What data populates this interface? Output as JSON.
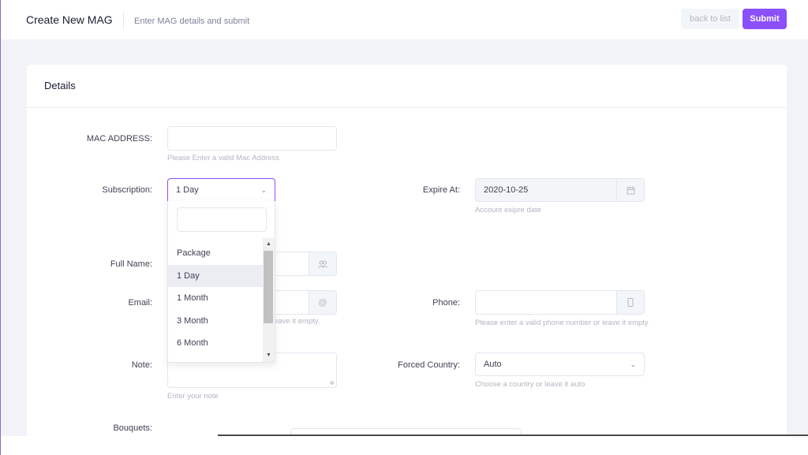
{
  "header": {
    "title": "Create New MAG",
    "subtitle": "Enter MAG details and submit",
    "back_label": "back to list",
    "submit_label": "Submit"
  },
  "card": {
    "title": "Details"
  },
  "form": {
    "mac": {
      "label": "MAC ADDRESS:",
      "value": "",
      "hint": "Please Enter a valid Mac Address"
    },
    "subscription": {
      "label": "Subscription:",
      "selected": "1 Day",
      "options": [
        "Package",
        "1 Day",
        "1 Month",
        "3 Month",
        "6 Month"
      ],
      "active_index": 1
    },
    "expire": {
      "label": "Expire At:",
      "value": "2020-10-25",
      "hint": "Account exipre date",
      "icon": "calendar-icon"
    },
    "fullname": {
      "label": "Full Name:",
      "icon": "users-icon"
    },
    "email": {
      "label": "Email:",
      "icon": "at-icon",
      "hint_partial": "eave it empty."
    },
    "phone": {
      "label": "Phone:",
      "icon": "phone-icon",
      "hint": "Please enter a valid phone number or leave it empty"
    },
    "note": {
      "label": "Note:",
      "hint": "Enter your note"
    },
    "country": {
      "label": "Forced Country:",
      "selected": "Auto",
      "hint": "Choose a country or leave it auto"
    },
    "bouquets": {
      "label": "Bouquets:"
    }
  },
  "colors": {
    "accent": "#8950fc",
    "muted": "#b5b5c3",
    "background": "#f2f3f8"
  }
}
